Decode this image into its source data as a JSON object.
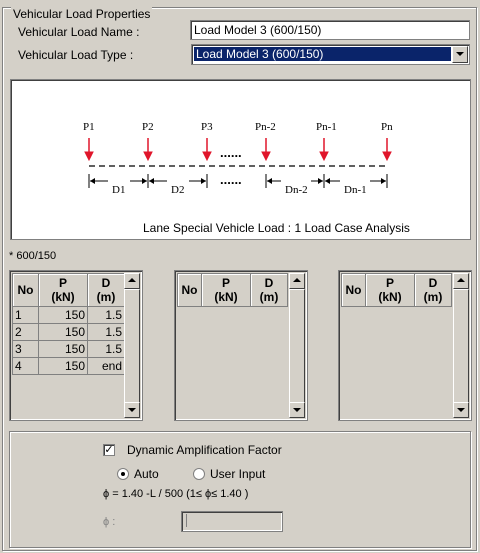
{
  "group_title": "Vehicular Load Properties",
  "name_field": {
    "label": "Vehicular Load Name :",
    "value": "Load Model 3 (600/150)"
  },
  "type_field": {
    "label": "Vehicular Load Type :",
    "value": "Load Model 3 (600/150)"
  },
  "diagram": {
    "loads": [
      "P1",
      "P2",
      "P3",
      "Pn-2",
      "Pn-1",
      "Pn"
    ],
    "spacings": [
      "D1",
      "D2",
      "Dn-2",
      "Dn-1"
    ],
    "ellipsis": "......",
    "caption": "Lane Special Vehicle Load : 1 Load Case Analysis",
    "arrow_color": "#e0162b"
  },
  "note": "* 600/150",
  "grid_headers": {
    "no": "No",
    "p": "P",
    "p_unit": "(kN)",
    "d": "D",
    "d_unit": "(m)"
  },
  "grid1_rows": [
    {
      "no": "1",
      "p": "150",
      "d": "1.5"
    },
    {
      "no": "2",
      "p": "150",
      "d": "1.5"
    },
    {
      "no": "3",
      "p": "150",
      "d": "1.5"
    },
    {
      "no": "4",
      "p": "150",
      "d": "end"
    }
  ],
  "daf": {
    "checkbox_label": "Dynamic Amplification Factor",
    "checked": true,
    "auto_label": "Auto",
    "user_input_label": "User Input",
    "selected": "Auto",
    "formula": "ϕ = 1.40 -L / 500  (1≤ ϕ≤ 1.40 )",
    "phi_label": "ϕ :",
    "phi_value": ""
  }
}
